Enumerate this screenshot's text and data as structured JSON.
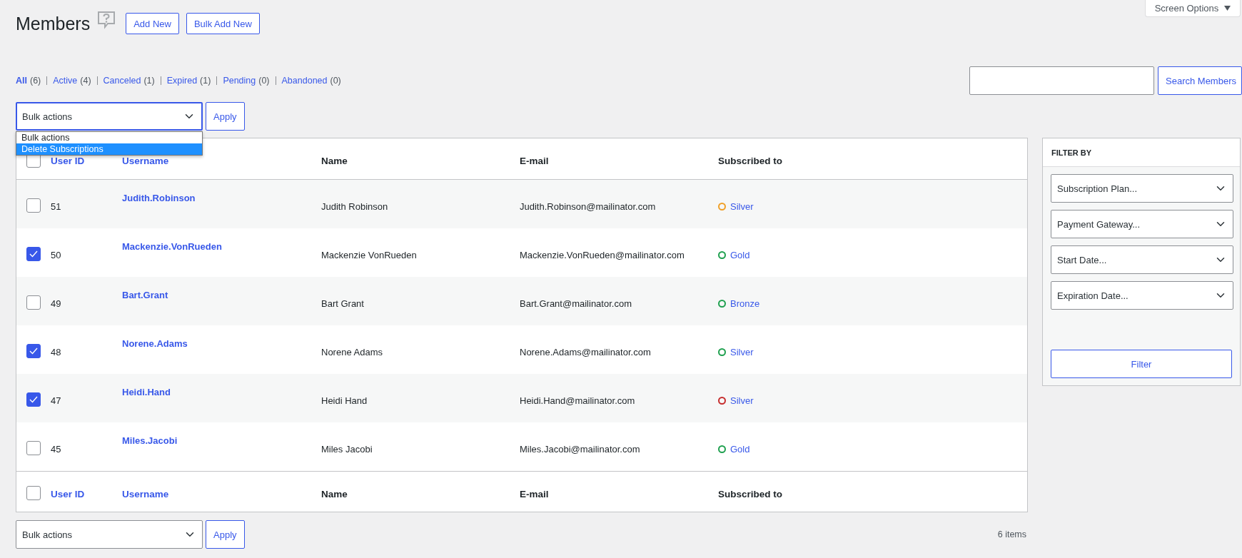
{
  "page": {
    "title": "Members",
    "actions": [
      "Add New",
      "Bulk Add New"
    ],
    "screen_options": "Screen Options"
  },
  "views": [
    {
      "label": "All",
      "count": "(6)",
      "selected": true
    },
    {
      "label": "Active",
      "count": "(4)",
      "selected": false
    },
    {
      "label": "Canceled",
      "count": "(1)",
      "selected": false
    },
    {
      "label": "Expired",
      "count": "(1)",
      "selected": false
    },
    {
      "label": "Pending",
      "count": "(0)",
      "selected": false
    },
    {
      "label": "Abandoned",
      "count": "(0)",
      "selected": false
    }
  ],
  "search": {
    "button": "Search Members"
  },
  "bulk_top": {
    "value": "Bulk actions",
    "expanded": true,
    "apply": "Apply",
    "options": [
      {
        "label": "Bulk actions",
        "highlighted": false
      },
      {
        "label": "Delete Subscriptions",
        "highlighted": true
      }
    ]
  },
  "table": {
    "select_all_checked": false,
    "columns": [
      {
        "label": "User ID",
        "sortable": true
      },
      {
        "label": "Username",
        "sortable": true
      },
      {
        "label": "Name",
        "sortable": false
      },
      {
        "label": "E-mail",
        "sortable": false
      },
      {
        "label": "Subscribed to",
        "sortable": false
      }
    ],
    "rows": [
      {
        "checked": false,
        "id": "51",
        "username": "Judith.Robinson",
        "name": "Judith Robinson",
        "email": "Judith.Robinson@mailinator.com",
        "plan": "Silver",
        "color": "#f0a028"
      },
      {
        "checked": true,
        "id": "50",
        "username": "Mackenzie.VonRueden",
        "name": "Mackenzie VonRueden",
        "email": "Mackenzie.VonRueden@mailinator.com",
        "plan": "Gold",
        "color": "#1fa04f"
      },
      {
        "checked": false,
        "id": "49",
        "username": "Bart.Grant",
        "name": "Bart Grant",
        "email": "Bart.Grant@mailinator.com",
        "plan": "Bronze",
        "color": "#1fa04f"
      },
      {
        "checked": true,
        "id": "48",
        "username": "Norene.Adams",
        "name": "Norene Adams",
        "email": "Norene.Adams@mailinator.com",
        "plan": "Silver",
        "color": "#1fa04f"
      },
      {
        "checked": true,
        "id": "47",
        "username": "Heidi.Hand",
        "name": "Heidi Hand",
        "email": "Heidi.Hand@mailinator.com",
        "plan": "Silver",
        "color": "#c62d2d"
      },
      {
        "checked": false,
        "id": "45",
        "username": "Miles.Jacobi",
        "name": "Miles Jacobi",
        "email": "Miles.Jacobi@mailinator.com",
        "plan": "Gold",
        "color": "#1fa04f"
      }
    ],
    "footer_checked": false,
    "footer_columns": [
      {
        "label": "User ID",
        "sortable": true
      },
      {
        "label": "Username",
        "sortable": true
      },
      {
        "label": "Name",
        "sortable": false
      },
      {
        "label": "E-mail",
        "sortable": false
      },
      {
        "label": "Subscribed to",
        "sortable": false
      }
    ]
  },
  "bulk_bottom": {
    "value": "Bulk actions",
    "apply": "Apply",
    "count": "6 items"
  },
  "filter_panel": {
    "title": "FILTER BY",
    "selects": [
      "Subscription Plan...",
      "Payment Gateway...",
      "Start Date...",
      "Expiration Date..."
    ],
    "button": "Filter"
  }
}
